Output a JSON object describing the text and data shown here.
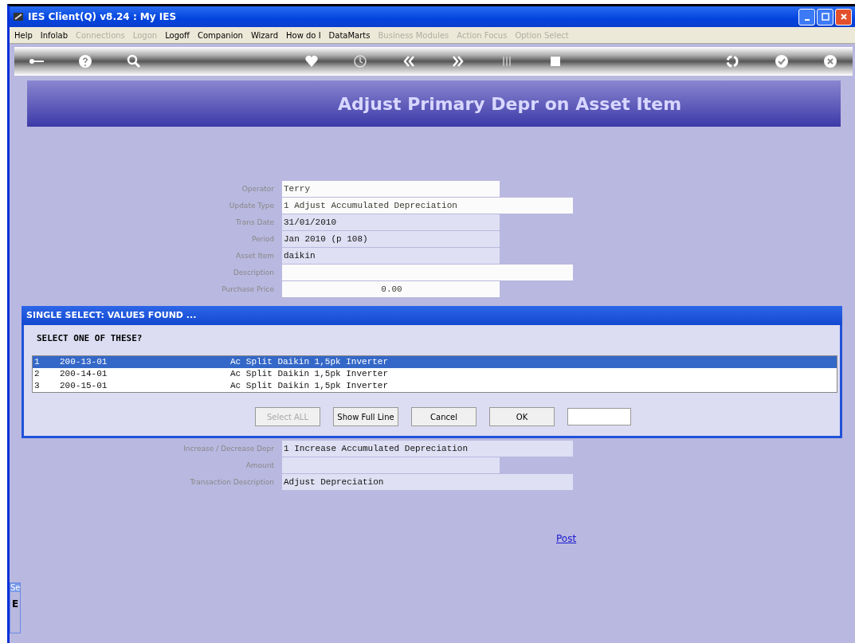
{
  "window": {
    "title": "IES Client(Q) v8.24 : My IES"
  },
  "menu": [
    {
      "label": "Help",
      "disabled": false
    },
    {
      "label": "Infolab",
      "disabled": false
    },
    {
      "label": "Connections",
      "disabled": true
    },
    {
      "label": "Logon",
      "disabled": true
    },
    {
      "label": "Logoff",
      "disabled": false
    },
    {
      "label": "Companion",
      "disabled": false
    },
    {
      "label": "Wizard",
      "disabled": false
    },
    {
      "label": "How do I",
      "disabled": false
    },
    {
      "label": "DataMarts",
      "disabled": false
    },
    {
      "label": "Business Modules",
      "disabled": true
    },
    {
      "label": "Action Focus",
      "disabled": true
    },
    {
      "label": "Option Select",
      "disabled": true
    }
  ],
  "page_title": "Adjust Primary Depr on Asset Item",
  "form_top": [
    {
      "label": "Operator",
      "value": "Terry",
      "kind": "short",
      "editable": true
    },
    {
      "label": "Update Type",
      "value": "1 Adjust Accumulated Depreciation",
      "kind": "long",
      "editable": true
    },
    {
      "label": "Trans Date",
      "value": "31/01/2010",
      "kind": "short",
      "editable": false
    },
    {
      "label": "Period",
      "value": "Jan 2010 (p 108)",
      "kind": "short",
      "editable": false
    },
    {
      "label": "Asset Item",
      "value": "daikin",
      "kind": "short",
      "editable": false
    },
    {
      "label": "Description",
      "kind": "long",
      "editable": true
    },
    {
      "label": "Purchase Price",
      "value": "0.00",
      "kind": "amount",
      "editable": true
    }
  ],
  "form_bottom": [
    {
      "label": "Increase / Decrease Depr",
      "value": "1 Increase Accumulated Depreciation",
      "kind": "long",
      "editable": false
    },
    {
      "label": "Amount",
      "kind": "short",
      "editable": false
    },
    {
      "label": "Transaction Description",
      "value": "Adjust Depreciation",
      "kind": "long",
      "editable": false
    }
  ],
  "post_link": "Post",
  "side_panel": {
    "title": "Se",
    "text": "E"
  },
  "dialog": {
    "title": "SINGLE SELECT: VALUES FOUND ...",
    "prompt": "SELECT ONE OF THESE?",
    "rows": [
      {
        "index": "1",
        "code": "200-13-01",
        "description": "Ac Split Daikin 1,5pk Inverter",
        "selected": true
      },
      {
        "index": "2",
        "code": "200-14-01",
        "description": "Ac Split Daikin 1,5pk Inverter",
        "selected": false
      },
      {
        "index": "3",
        "code": "200-15-01",
        "description": "Ac Split Daikin 1,5pk Inverter",
        "selected": false
      }
    ],
    "buttons": [
      {
        "label": "Select ALL",
        "disabled": true
      },
      {
        "label": "Show Full Line",
        "disabled": false
      },
      {
        "label": "Cancel",
        "disabled": false
      },
      {
        "label": "OK",
        "disabled": false
      }
    ]
  }
}
